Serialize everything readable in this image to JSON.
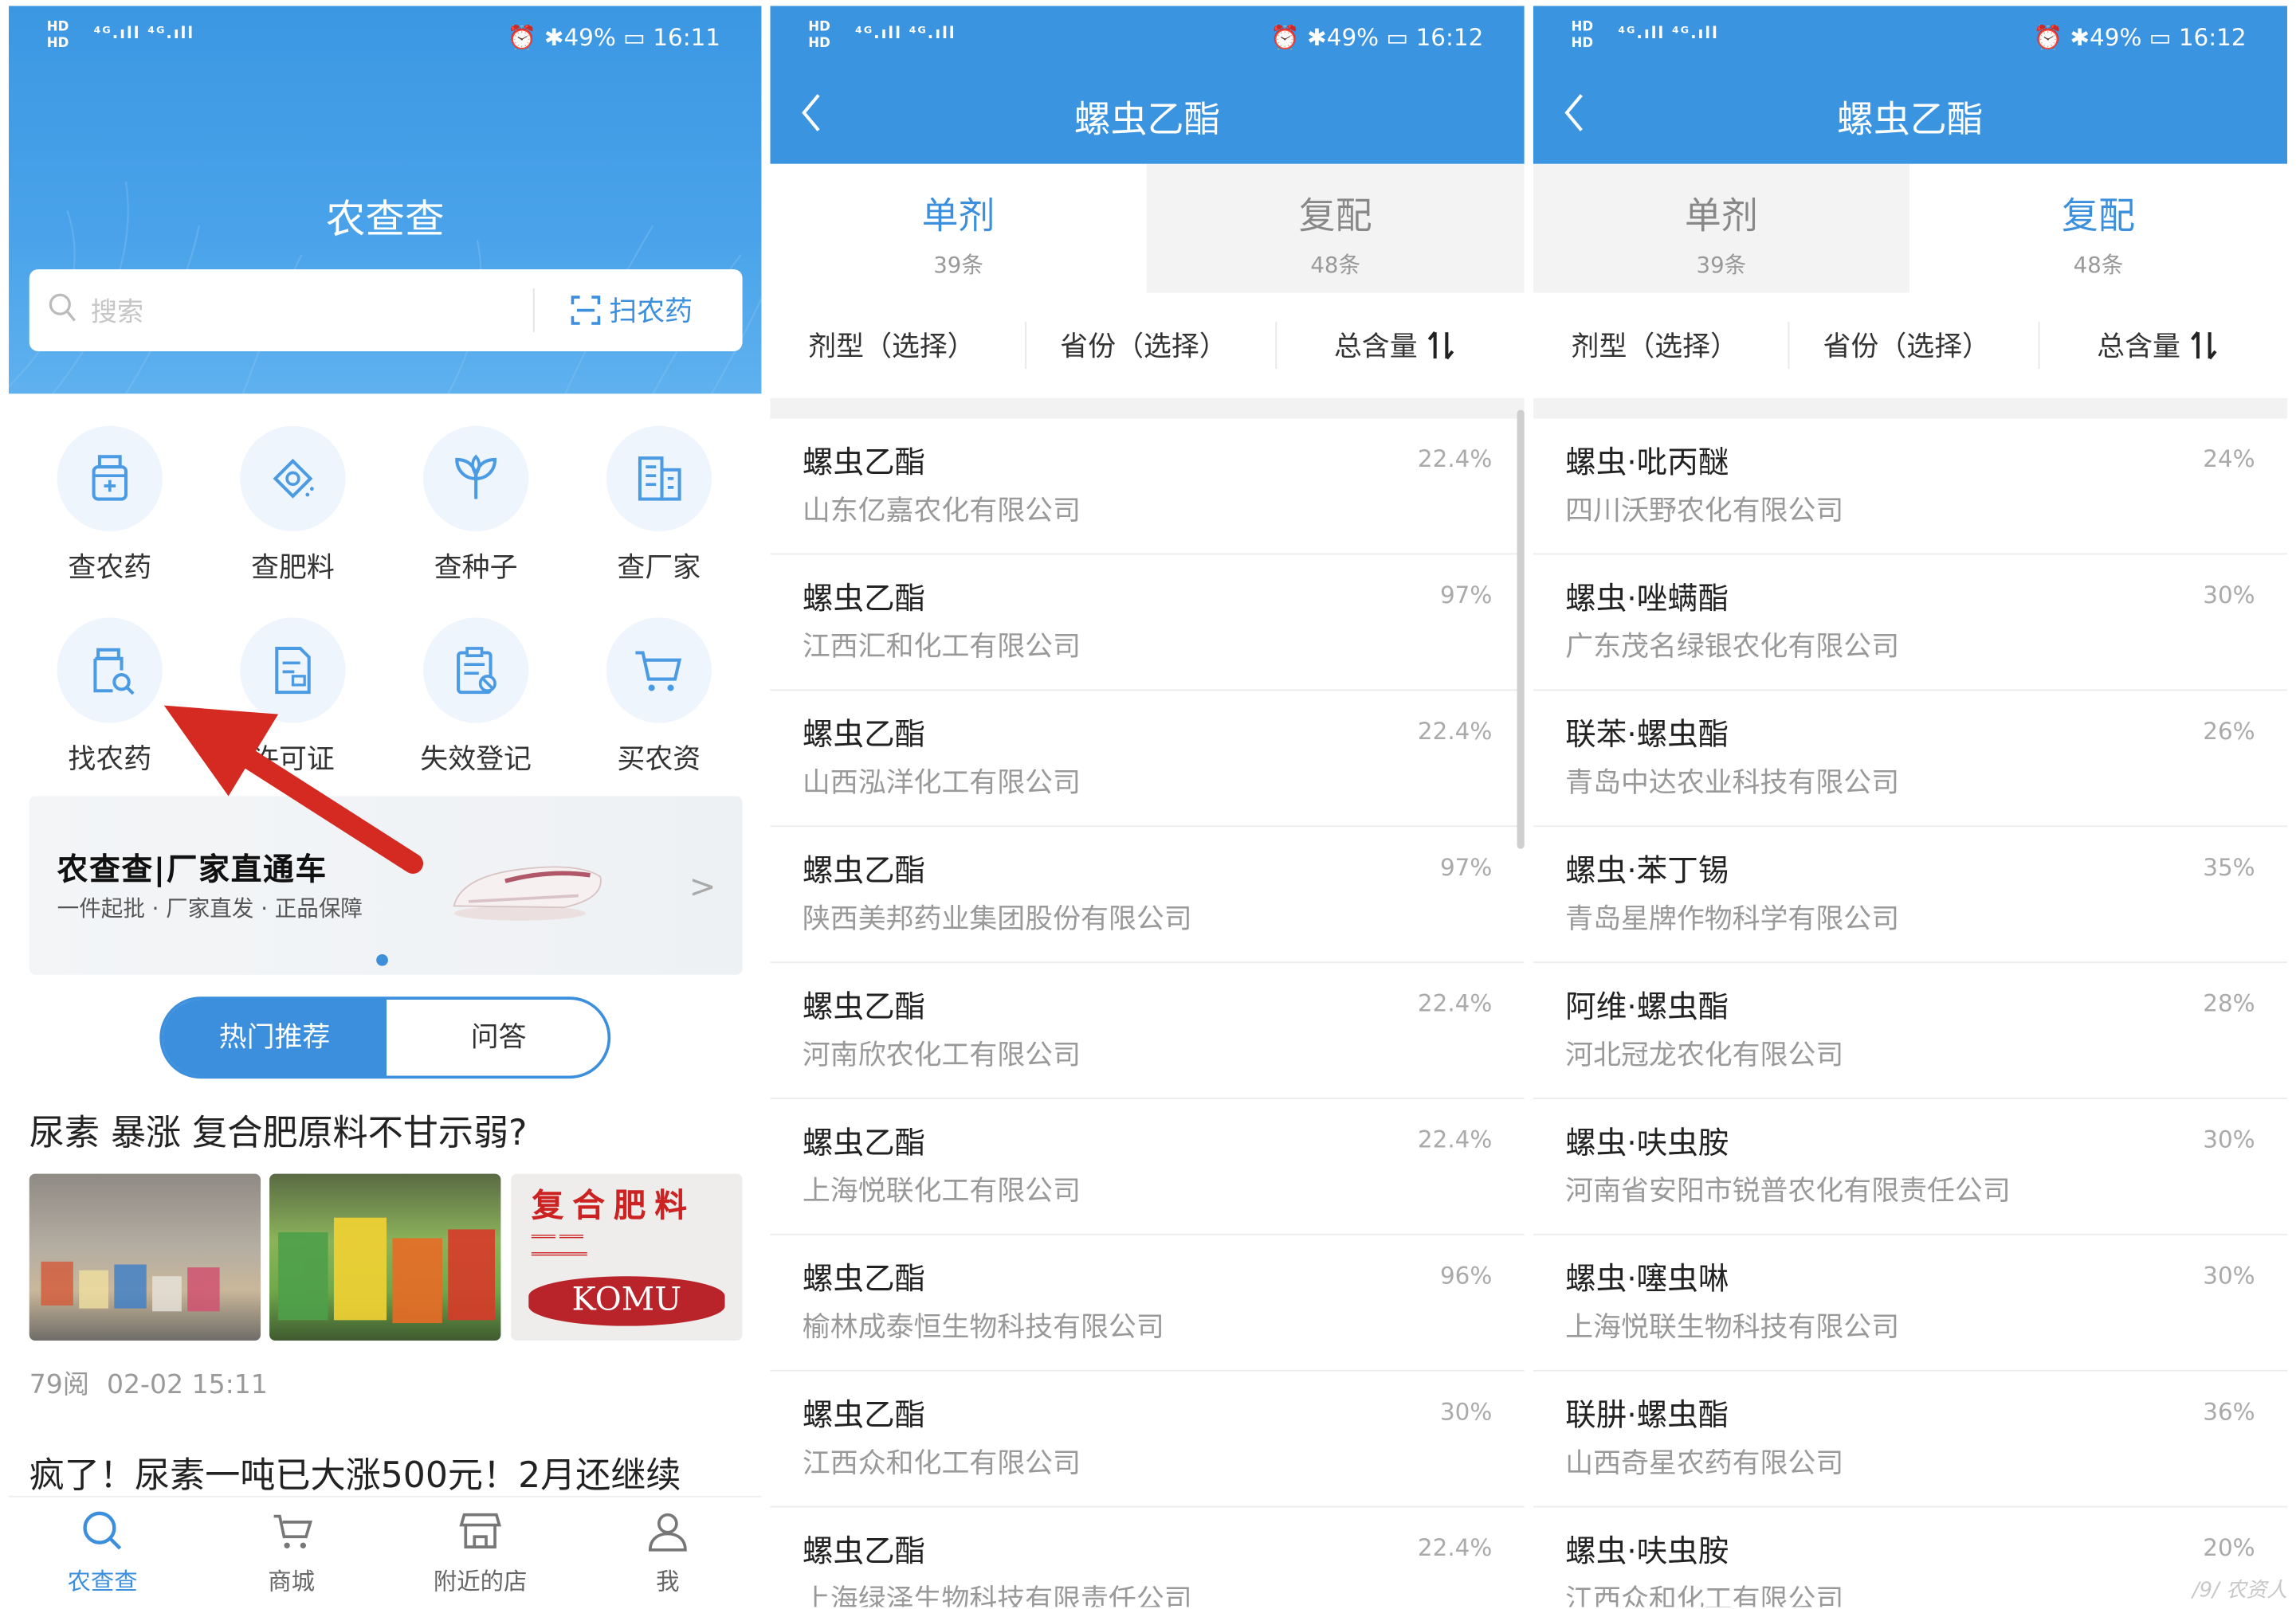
{
  "status_left": {
    "hd1": "HD",
    "hd2": "HD",
    "net": "⁴ᴳ.ıll ⁴ᴳ.ıll"
  },
  "screen1": {
    "status_right": "⏰ ✱49% ▭ 16:11",
    "app_title": "农查查",
    "search": {
      "placeholder": "搜索",
      "scan_label": "扫农药"
    },
    "grid": [
      {
        "label": "查农药",
        "icon": "pesticide-bottle-icon"
      },
      {
        "label": "查肥料",
        "icon": "fertilizer-bag-icon"
      },
      {
        "label": "查种子",
        "icon": "seed-sprout-icon"
      },
      {
        "label": "查厂家",
        "icon": "factory-building-icon"
      },
      {
        "label": "找农药",
        "icon": "find-pesticide-icon"
      },
      {
        "label": "许可证",
        "icon": "license-document-icon"
      },
      {
        "label": "失效登记",
        "icon": "invalid-registration-icon"
      },
      {
        "label": "买农资",
        "icon": "shopping-cart-icon"
      }
    ],
    "banner": {
      "title": "农查查|厂家直通车",
      "subtitle": "一件起批 · 厂家直发 · 正品保障"
    },
    "segment": {
      "active": "热门推荐",
      "inactive": "问答"
    },
    "news1": {
      "title": "尿素 暴涨 复合肥原料不甘示弱?",
      "views": "79阅",
      "date": "02-02 15:11",
      "thumb3_text1": "复合肥料",
      "thumb3_text2": "KOMU"
    },
    "news2": {
      "title": "疯了！尿素一吨已大涨500元！2月还继续"
    },
    "tabbar": [
      {
        "label": "农查查",
        "icon": "search-icon",
        "active": true
      },
      {
        "label": "商城",
        "icon": "cart-icon",
        "active": false
      },
      {
        "label": "附近的店",
        "icon": "store-icon",
        "active": false
      },
      {
        "label": "我",
        "icon": "user-icon",
        "active": false
      }
    ]
  },
  "screen2": {
    "status_right": "⏰ ✱49% ▭ 16:12",
    "title": "螺虫乙酯",
    "tabs": [
      {
        "name": "单剂",
        "count": "39条",
        "active": true
      },
      {
        "name": "复配",
        "count": "48条",
        "active": false
      }
    ],
    "filters": {
      "form": "剂型（选择）",
      "province": "省份（选择）",
      "total": "总含量"
    },
    "rows": [
      {
        "name": "螺虫乙酯",
        "company": "山东亿嘉农化有限公司",
        "pct": "22.4%"
      },
      {
        "name": "螺虫乙酯",
        "company": "江西汇和化工有限公司",
        "pct": "97%"
      },
      {
        "name": "螺虫乙酯",
        "company": "山西泓洋化工有限公司",
        "pct": "22.4%"
      },
      {
        "name": "螺虫乙酯",
        "company": "陕西美邦药业集团股份有限公司",
        "pct": "97%"
      },
      {
        "name": "螺虫乙酯",
        "company": "河南欣农化工有限公司",
        "pct": "22.4%"
      },
      {
        "name": "螺虫乙酯",
        "company": "上海悦联化工有限公司",
        "pct": "22.4%"
      },
      {
        "name": "螺虫乙酯",
        "company": "榆林成泰恒生物科技有限公司",
        "pct": "96%"
      },
      {
        "name": "螺虫乙酯",
        "company": "江西众和化工有限公司",
        "pct": "30%"
      },
      {
        "name": "螺虫乙酯",
        "company": "上海绿泽生物科技有限责任公司",
        "pct": "22.4%"
      }
    ]
  },
  "screen3": {
    "status_right": "⏰ ✱49% ▭ 16:12",
    "title": "螺虫乙酯",
    "tabs": [
      {
        "name": "单剂",
        "count": "39条",
        "active": false
      },
      {
        "name": "复配",
        "count": "48条",
        "active": true
      }
    ],
    "filters": {
      "form": "剂型（选择）",
      "province": "省份（选择）",
      "total": "总含量"
    },
    "rows": [
      {
        "name": "螺虫·吡丙醚",
        "company": "四川沃野农化有限公司",
        "pct": "24%"
      },
      {
        "name": "螺虫·唑螨酯",
        "company": "广东茂名绿银农化有限公司",
        "pct": "30%"
      },
      {
        "name": "联苯·螺虫酯",
        "company": "青岛中达农业科技有限公司",
        "pct": "26%"
      },
      {
        "name": "螺虫·苯丁锡",
        "company": "青岛星牌作物科学有限公司",
        "pct": "35%"
      },
      {
        "name": "阿维·螺虫酯",
        "company": "河北冠龙农化有限公司",
        "pct": "28%"
      },
      {
        "name": "螺虫·呋虫胺",
        "company": "河南省安阳市锐普农化有限责任公司",
        "pct": "30%"
      },
      {
        "name": "螺虫·噻虫啉",
        "company": "上海悦联生物科技有限公司",
        "pct": "30%"
      },
      {
        "name": "联肼·螺虫酯",
        "company": "山西奇星农药有限公司",
        "pct": "36%"
      },
      {
        "name": "螺虫·呋虫胺",
        "company": "江西众和化工有限公司",
        "pct": "20%"
      }
    ]
  },
  "watermark": "/9/ 农资人",
  "colors": {
    "primary": "#3a94e0",
    "accent": "#3b8fdc",
    "arrow": "#d42a22"
  }
}
